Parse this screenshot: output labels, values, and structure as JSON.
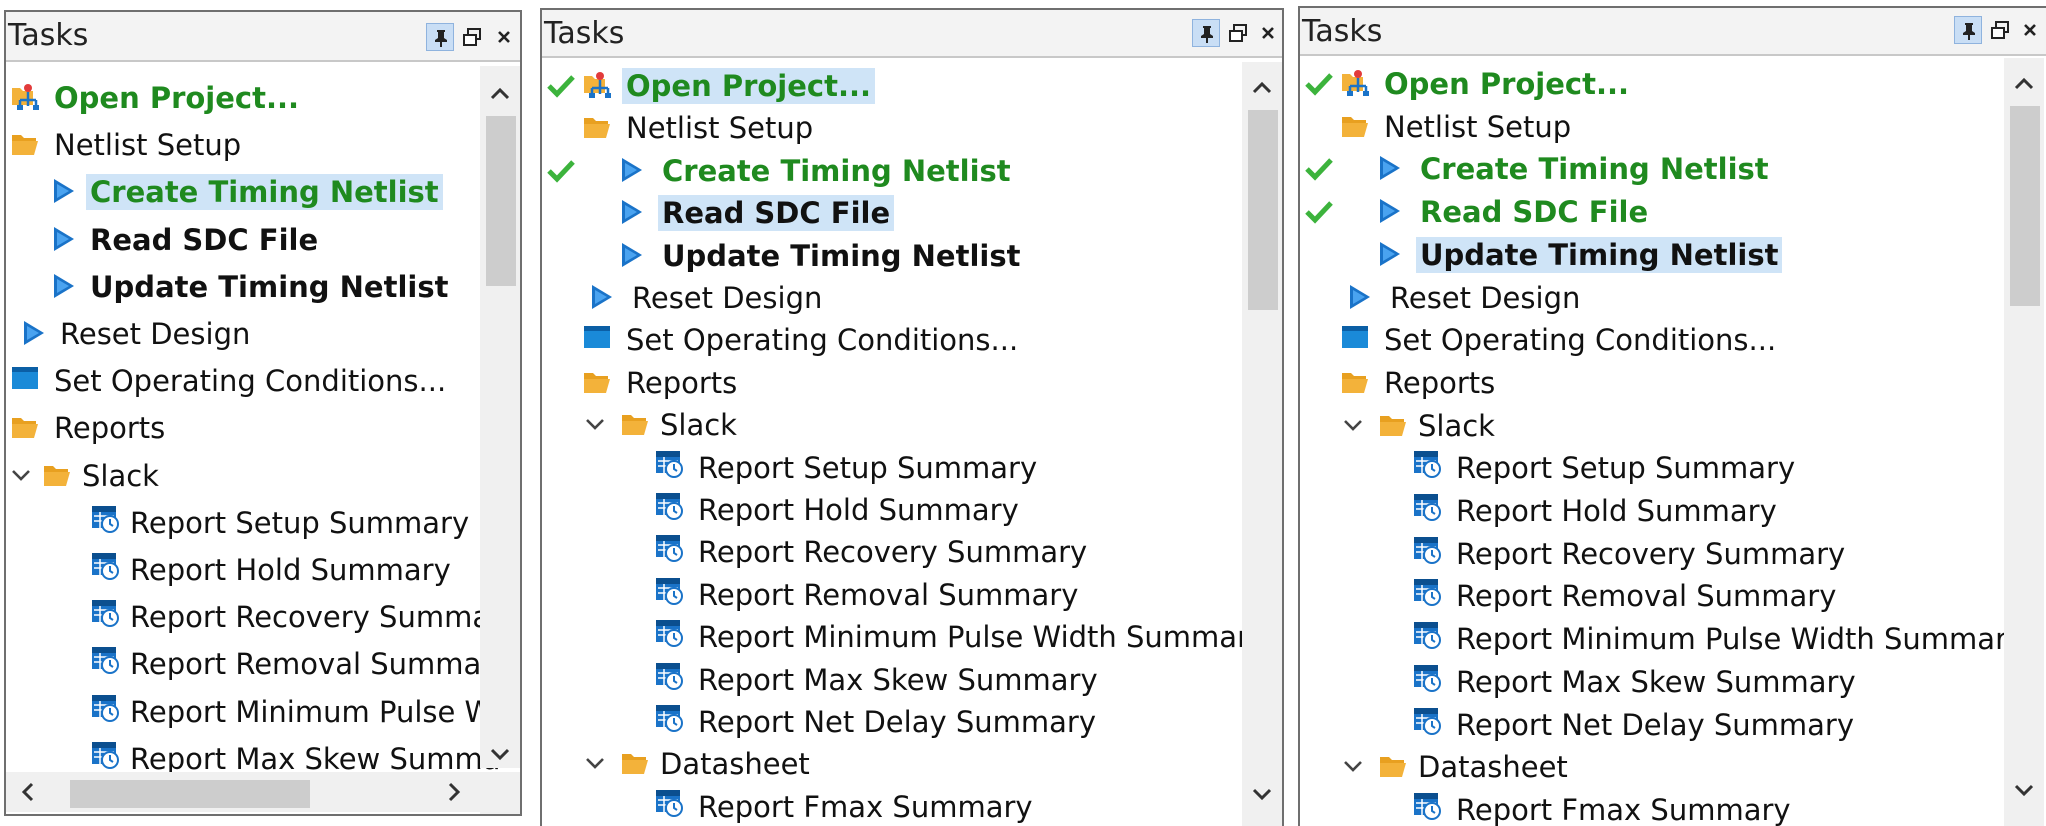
{
  "panels": [
    {
      "title": "Tasks",
      "items": [
        {
          "label": "Open Project...",
          "icon": "project-network-icon",
          "style": "green",
          "checked": false,
          "selected": false
        },
        {
          "label": "Netlist Setup",
          "icon": "folder-open-icon",
          "style": "normal",
          "checked": false,
          "selected": false
        },
        {
          "label": "Create Timing Netlist",
          "icon": "play-triangle-icon",
          "style": "green",
          "checked": false,
          "selected": true
        },
        {
          "label": "Read SDC File",
          "icon": "play-triangle-icon",
          "style": "bold",
          "checked": false,
          "selected": false
        },
        {
          "label": "Update Timing Netlist",
          "icon": "play-triangle-icon",
          "style": "bold",
          "checked": false,
          "selected": false
        },
        {
          "label": "Reset Design",
          "icon": "play-triangle-icon",
          "style": "normal",
          "checked": false,
          "selected": false
        },
        {
          "label": "Set Operating Conditions...",
          "icon": "conditions-window-icon",
          "style": "normal",
          "checked": false,
          "selected": false
        },
        {
          "label": "Reports",
          "icon": "folder-open-icon",
          "style": "normal",
          "checked": false,
          "selected": false
        },
        {
          "label": "Slack",
          "icon": "folder-open-icon",
          "style": "normal",
          "checked": false,
          "selected": false,
          "expander": "chevron-down-icon"
        },
        {
          "label": "Report Setup Summary",
          "icon": "report-clock-icon",
          "style": "normal",
          "checked": false,
          "selected": false
        },
        {
          "label": "Report Hold Summary",
          "icon": "report-clock-icon",
          "style": "normal",
          "checked": false,
          "selected": false
        },
        {
          "label": "Report Recovery Summa",
          "icon": "report-clock-icon",
          "style": "normal",
          "checked": false,
          "selected": false
        },
        {
          "label": "Report Removal Summar",
          "icon": "report-clock-icon",
          "style": "normal",
          "checked": false,
          "selected": false
        },
        {
          "label": "Report Minimum Pulse W",
          "icon": "report-clock-icon",
          "style": "normal",
          "checked": false,
          "selected": false
        },
        {
          "label": "Report Max Skew Summa",
          "icon": "report-clock-icon",
          "style": "normal",
          "checked": false,
          "selected": false
        }
      ]
    },
    {
      "title": "Tasks",
      "items": [
        {
          "label": "Open Project...",
          "icon": "project-network-icon",
          "style": "green",
          "checked": true,
          "selected": true
        },
        {
          "label": "Netlist Setup",
          "icon": "folder-open-icon",
          "style": "normal",
          "checked": false,
          "selected": false
        },
        {
          "label": "Create Timing Netlist",
          "icon": "play-triangle-icon",
          "style": "green",
          "checked": true,
          "selected": false
        },
        {
          "label": "Read SDC File",
          "icon": "play-triangle-icon",
          "style": "bold",
          "checked": false,
          "selected": true
        },
        {
          "label": "Update Timing Netlist",
          "icon": "play-triangle-icon",
          "style": "bold",
          "checked": false,
          "selected": false
        },
        {
          "label": "Reset Design",
          "icon": "play-triangle-icon",
          "style": "normal",
          "checked": false,
          "selected": false
        },
        {
          "label": "Set Operating Conditions...",
          "icon": "conditions-window-icon",
          "style": "normal",
          "checked": false,
          "selected": false
        },
        {
          "label": "Reports",
          "icon": "folder-open-icon",
          "style": "normal",
          "checked": false,
          "selected": false
        },
        {
          "label": "Slack",
          "icon": "folder-open-icon",
          "style": "normal",
          "checked": false,
          "selected": false,
          "expander": "chevron-down-icon"
        },
        {
          "label": "Report Setup Summary",
          "icon": "report-clock-icon",
          "style": "normal",
          "checked": false,
          "selected": false
        },
        {
          "label": "Report Hold Summary",
          "icon": "report-clock-icon",
          "style": "normal",
          "checked": false,
          "selected": false
        },
        {
          "label": "Report Recovery Summary",
          "icon": "report-clock-icon",
          "style": "normal",
          "checked": false,
          "selected": false
        },
        {
          "label": "Report Removal Summary",
          "icon": "report-clock-icon",
          "style": "normal",
          "checked": false,
          "selected": false
        },
        {
          "label": "Report Minimum Pulse Width Summary",
          "icon": "report-clock-icon",
          "style": "normal",
          "checked": false,
          "selected": false
        },
        {
          "label": "Report Max Skew Summary",
          "icon": "report-clock-icon",
          "style": "normal",
          "checked": false,
          "selected": false
        },
        {
          "label": "Report Net Delay Summary",
          "icon": "report-clock-icon",
          "style": "normal",
          "checked": false,
          "selected": false
        },
        {
          "label": "Datasheet",
          "icon": "folder-open-icon",
          "style": "normal",
          "checked": false,
          "selected": false,
          "expander": "chevron-down-icon"
        },
        {
          "label": "Report Fmax Summary",
          "icon": "report-clock-icon",
          "style": "normal",
          "checked": false,
          "selected": false
        }
      ]
    },
    {
      "title": "Tasks",
      "items": [
        {
          "label": "Open Project...",
          "icon": "project-network-icon",
          "style": "green",
          "checked": true,
          "selected": false
        },
        {
          "label": "Netlist Setup",
          "icon": "folder-open-icon",
          "style": "normal",
          "checked": false,
          "selected": false
        },
        {
          "label": "Create Timing Netlist",
          "icon": "play-triangle-icon",
          "style": "green",
          "checked": true,
          "selected": false
        },
        {
          "label": "Read SDC File",
          "icon": "play-triangle-icon",
          "style": "green",
          "checked": true,
          "selected": false
        },
        {
          "label": "Update Timing Netlist",
          "icon": "play-triangle-icon",
          "style": "bold",
          "checked": false,
          "selected": true
        },
        {
          "label": "Reset Design",
          "icon": "play-triangle-icon",
          "style": "normal",
          "checked": false,
          "selected": false
        },
        {
          "label": "Set Operating Conditions...",
          "icon": "conditions-window-icon",
          "style": "normal",
          "checked": false,
          "selected": false
        },
        {
          "label": "Reports",
          "icon": "folder-open-icon",
          "style": "normal",
          "checked": false,
          "selected": false
        },
        {
          "label": "Slack",
          "icon": "folder-open-icon",
          "style": "normal",
          "checked": false,
          "selected": false,
          "expander": "chevron-down-icon"
        },
        {
          "label": "Report Setup Summary",
          "icon": "report-clock-icon",
          "style": "normal",
          "checked": false,
          "selected": false
        },
        {
          "label": "Report Hold Summary",
          "icon": "report-clock-icon",
          "style": "normal",
          "checked": false,
          "selected": false
        },
        {
          "label": "Report Recovery Summary",
          "icon": "report-clock-icon",
          "style": "normal",
          "checked": false,
          "selected": false
        },
        {
          "label": "Report Removal Summary",
          "icon": "report-clock-icon",
          "style": "normal",
          "checked": false,
          "selected": false
        },
        {
          "label": "Report Minimum Pulse Width Summary",
          "icon": "report-clock-icon",
          "style": "normal",
          "checked": false,
          "selected": false
        },
        {
          "label": "Report Max Skew Summary",
          "icon": "report-clock-icon",
          "style": "normal",
          "checked": false,
          "selected": false
        },
        {
          "label": "Report Net Delay Summary",
          "icon": "report-clock-icon",
          "style": "normal",
          "checked": false,
          "selected": false
        },
        {
          "label": "Datasheet",
          "icon": "folder-open-icon",
          "style": "normal",
          "checked": false,
          "selected": false,
          "expander": "chevron-down-icon"
        },
        {
          "label": "Report Fmax Summary",
          "icon": "report-clock-icon",
          "style": "normal",
          "checked": false,
          "selected": false
        }
      ]
    }
  ],
  "colors": {
    "green_text": "#1f8a1f",
    "selection": "#cfe4f7",
    "play_blue": "#1a73c8",
    "folder": "#f3b23a"
  }
}
